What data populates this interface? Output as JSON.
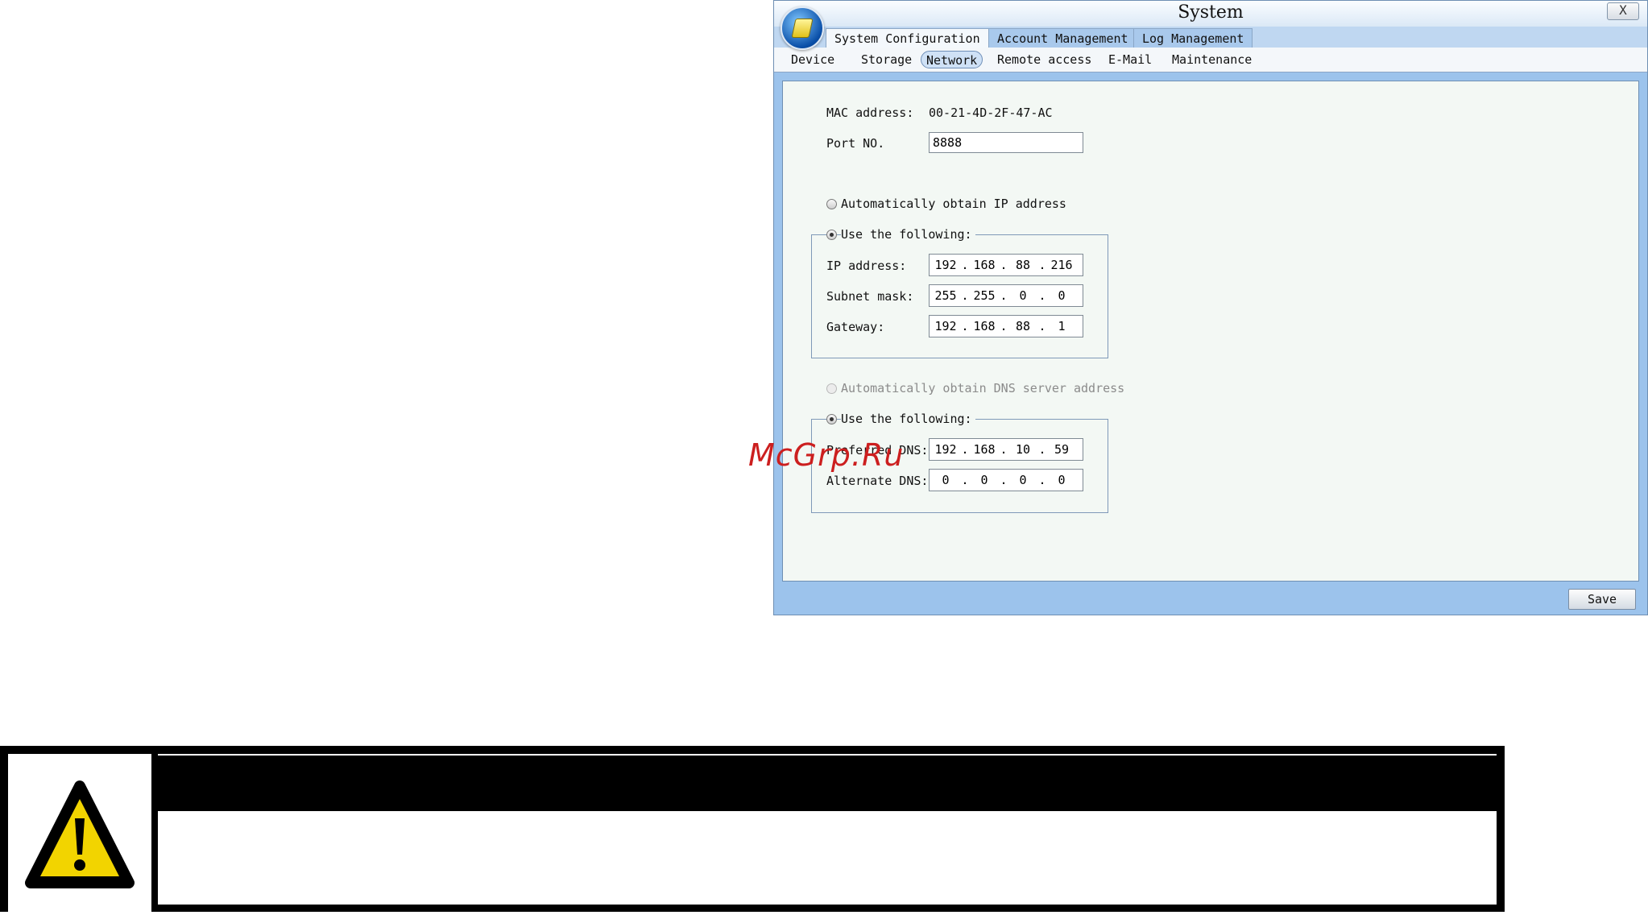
{
  "window": {
    "title": "System",
    "close_label": "X"
  },
  "tabs": [
    {
      "label": "System Configuration",
      "active": true
    },
    {
      "label": "Account Management",
      "active": false
    },
    {
      "label": "Log Management",
      "active": false
    }
  ],
  "subtabs": [
    {
      "label": "Device",
      "active": false
    },
    {
      "label": "Storage",
      "active": false
    },
    {
      "label": "Network",
      "active": true
    },
    {
      "label": "Remote access",
      "active": false
    },
    {
      "label": "E-Mail",
      "active": false
    },
    {
      "label": "Maintenance",
      "active": false
    }
  ],
  "network": {
    "mac_label": "MAC address:",
    "mac_value": "00-21-4D-2F-47-AC",
    "port_label": "Port NO.",
    "port_value": "8888",
    "auto_ip_label": "Automatically obtain IP address",
    "use_following_ip_label": "Use the following:",
    "ip_label": "IP address:",
    "ip": [
      "192",
      "168",
      "88",
      "216"
    ],
    "subnet_label": "Subnet mask:",
    "subnet": [
      "255",
      "255",
      "0",
      "0"
    ],
    "gateway_label": "Gateway:",
    "gateway": [
      "192",
      "168",
      "88",
      "1"
    ],
    "auto_dns_label": "Automatically obtain DNS server address",
    "use_following_dns_label": "Use the following:",
    "preferred_dns_label": "Preferred DNS:",
    "preferred_dns": [
      "192",
      "168",
      "10",
      "59"
    ],
    "alternate_dns_label": "Alternate DNS:",
    "alternate_dns": [
      "0",
      "0",
      "0",
      "0"
    ],
    "ip_mode": "manual",
    "dns_mode": "manual"
  },
  "footer": {
    "save_label": "Save"
  },
  "watermark": "McGrp.Ru",
  "colors": {
    "window_frame": "#9cc3ec",
    "panel_bg": "#f3f8f4",
    "warning_bg": "#000000",
    "warning_sign": "#f2d400"
  },
  "icons": {
    "app_logo": "app-logo-icon",
    "warning": "warning-triangle-icon"
  }
}
